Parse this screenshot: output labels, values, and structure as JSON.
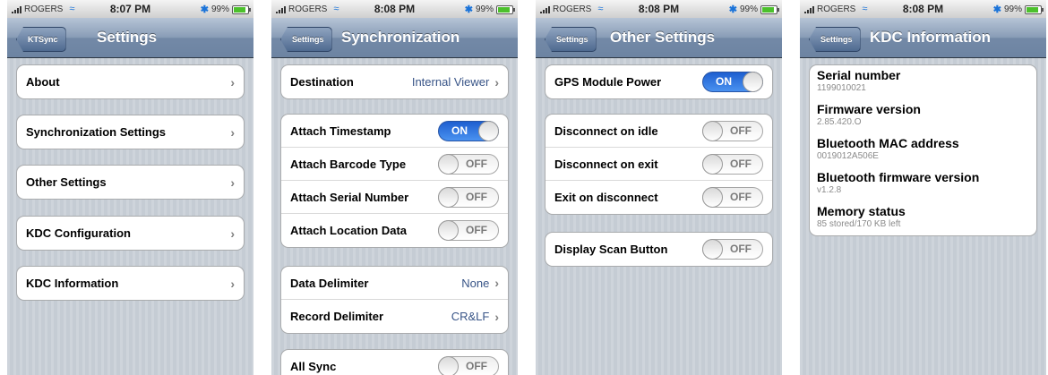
{
  "status": {
    "carrier": "ROGERS",
    "battery": "99%"
  },
  "screens": [
    {
      "time": "8:07 PM",
      "back": "KTSync",
      "title": "Settings",
      "items": [
        "About",
        "Synchronization Settings",
        "Other Settings",
        "KDC Configuration",
        "KDC Information"
      ]
    },
    {
      "time": "8:08 PM",
      "back": "Settings",
      "title": "Synchronization",
      "destination": {
        "label": "Destination",
        "value": "Internal Viewer"
      },
      "toggles": [
        {
          "label": "Attach Timestamp",
          "state": "ON"
        },
        {
          "label": "Attach Barcode Type",
          "state": "OFF"
        },
        {
          "label": "Attach Serial Number",
          "state": "OFF"
        },
        {
          "label": "Attach Location Data",
          "state": "OFF"
        }
      ],
      "delimiters": [
        {
          "label": "Data Delimiter",
          "value": "None"
        },
        {
          "label": "Record Delimiter",
          "value": "CR&LF"
        }
      ],
      "all_sync": {
        "label": "All Sync",
        "state": "OFF"
      }
    },
    {
      "time": "8:08 PM",
      "back": "Settings",
      "title": "Other Settings",
      "gps": {
        "label": "GPS Module Power",
        "state": "ON"
      },
      "disconnect": [
        {
          "label": "Disconnect on idle",
          "state": "OFF"
        },
        {
          "label": "Disconnect on exit",
          "state": "OFF"
        },
        {
          "label": "Exit on disconnect",
          "state": "OFF"
        }
      ],
      "scan": {
        "label": "Display Scan Button",
        "state": "OFF"
      }
    },
    {
      "time": "8:08 PM",
      "back": "Settings",
      "title": "KDC Information",
      "info": [
        {
          "key": "Serial number",
          "value": "1199010021"
        },
        {
          "key": "Firmware version",
          "value": "2.85.420.O"
        },
        {
          "key": "Bluetooth MAC address",
          "value": "0019012A506E"
        },
        {
          "key": "Bluetooth firmware version",
          "value": "v1.2.8"
        },
        {
          "key": "Memory status",
          "value": "85 stored/170 KB left"
        }
      ]
    }
  ],
  "colors": {
    "toggle_on": "#2f74e0",
    "nav_bar": "#7a8fab",
    "value_text": "#385487",
    "background": "#c5ccd4"
  }
}
